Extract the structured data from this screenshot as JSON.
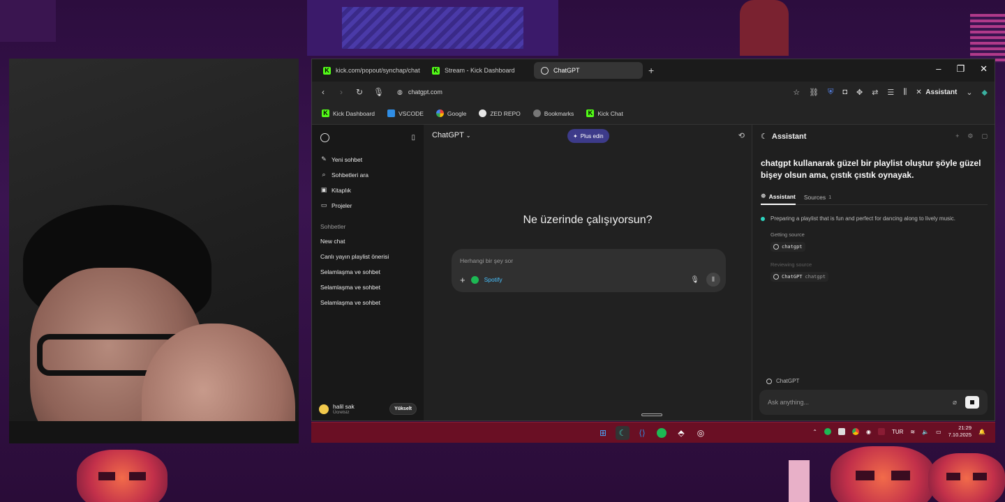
{
  "browser": {
    "tabs": [
      {
        "label": "kick.com/popout/synchap/chat",
        "icon": "kick-icon"
      },
      {
        "label": "Stream - Kick Dashboard",
        "icon": "kick-icon"
      },
      {
        "label": "ChatGPT",
        "icon": "chatgpt-icon",
        "active": true
      }
    ],
    "url": "chatgpt.com",
    "assistant_button": "Assistant",
    "bookmarks": [
      {
        "label": "Kick Dashboard",
        "icon": "kick-icon"
      },
      {
        "label": "VSCODE",
        "icon": "vscode-icon"
      },
      {
        "label": "Google",
        "icon": "google-icon"
      },
      {
        "label": "ZED REPO",
        "icon": "github-icon"
      },
      {
        "label": "Bookmarks",
        "icon": "bookmarks-icon"
      },
      {
        "label": "Kick Chat",
        "icon": "kick-icon"
      }
    ]
  },
  "sidebar": {
    "menu": [
      {
        "label": "Yeni sohbet",
        "icon": "edit-icon"
      },
      {
        "label": "Sohbetleri ara",
        "icon": "search-icon"
      },
      {
        "label": "Kitaplık",
        "icon": "library-icon"
      },
      {
        "label": "Projeler",
        "icon": "folder-icon"
      }
    ],
    "section_title": "Sohbetler",
    "chats": [
      "New chat",
      "Canlı yayın playlist önerisi",
      "Selamlaşma ve sohbet",
      "Selamlaşma ve sohbet",
      "Selamlaşma ve sohbet"
    ],
    "user": {
      "name": "halil sak",
      "plan": "Ücretsiz",
      "upgrade": "Yükselt"
    }
  },
  "main": {
    "model": "ChatGPT",
    "plus_button": "Plus edin",
    "headline": "Ne üzerinde çalışıyorsun?",
    "composer_placeholder": "Herhangi bir şey sor",
    "tool_label": "Spotify"
  },
  "assistant": {
    "title": "Assistant",
    "prompt": "chatgpt kullanarak güzel bir playlist oluştur şöyle güzel bişey olsun ama, çıstık çıstık oynayak.",
    "tabs": [
      {
        "label": "Assistant",
        "active": true
      },
      {
        "label": "Sources",
        "count": "1"
      }
    ],
    "status": "Preparing a playlist that is fun and perfect for dancing along to lively music.",
    "getting_label": "Getting source",
    "getting_source": "chatgpt",
    "reviewing_label": "Reviewing source",
    "reviewing_source": "ChatGPT",
    "reviewing_source_extra": "chatgpt",
    "footer_label": "ChatGPT",
    "ask_placeholder": "Ask anything..."
  },
  "taskbar": {
    "language": "TUR",
    "time": "21:29",
    "date": "7.10.2025"
  },
  "colors": {
    "kick_green": "#53fc18",
    "spotify_green": "#1db954",
    "plus_purple": "#3d3b8a",
    "taskbar_red": "#6a0f24"
  }
}
